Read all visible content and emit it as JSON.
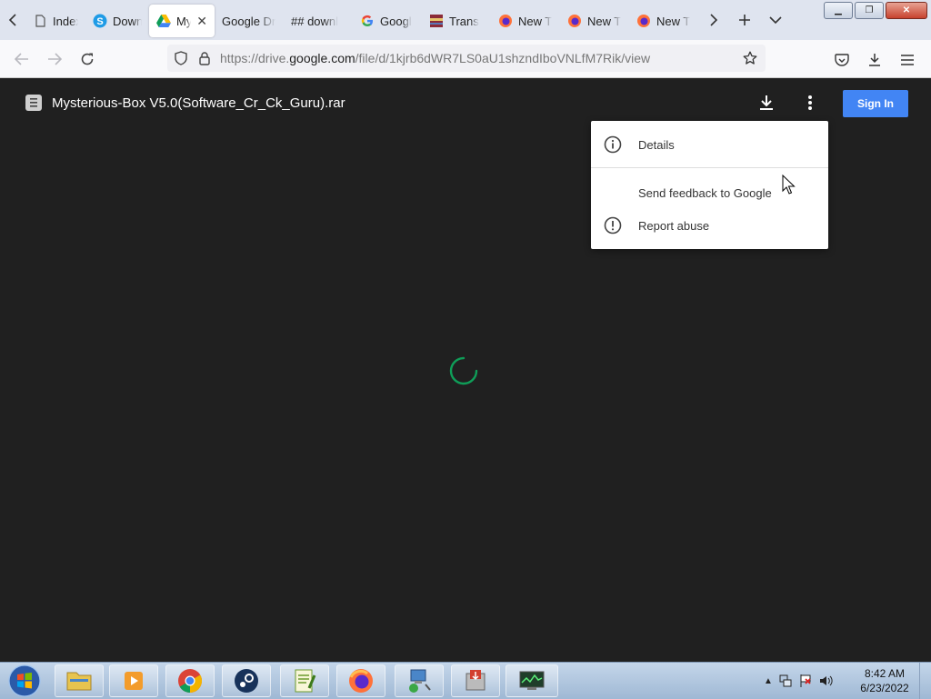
{
  "browser": {
    "tabs": [
      {
        "title": "Index",
        "icon": "generic-page-icon"
      },
      {
        "title": "Down",
        "icon": "s-logo-icon"
      },
      {
        "title": "My",
        "icon": "google-drive-icon",
        "active": true
      },
      {
        "title": "Google Dr",
        "icon": "none"
      },
      {
        "title": "## downl",
        "icon": "none"
      },
      {
        "title": "Googl",
        "icon": "google-g-icon"
      },
      {
        "title": "Trans",
        "icon": "winrar-icon"
      },
      {
        "title": "New T",
        "icon": "firefox-icon"
      },
      {
        "title": "New T",
        "icon": "firefox-icon"
      },
      {
        "title": "New T",
        "icon": "firefox-icon"
      }
    ],
    "url_prefix": "https://drive.",
    "url_domain": "google.com",
    "url_path": "/file/d/1kjrb6dWR7LS0aU1shzndIboVNLfM7Rik/view"
  },
  "viewer": {
    "file_name": "Mysterious-Box V5.0(Software_Cr_Ck_Guru).rar",
    "sign_in_label": "Sign In",
    "menu": {
      "details": "Details",
      "feedback": "Send feedback to Google",
      "report": "Report abuse"
    }
  },
  "taskbar": {
    "time": "8:42 AM",
    "date": "6/23/2022"
  },
  "colors": {
    "viewer_bg": "#202020",
    "accent_blue": "#4285f4",
    "spinner_green": "#0f9d58"
  }
}
